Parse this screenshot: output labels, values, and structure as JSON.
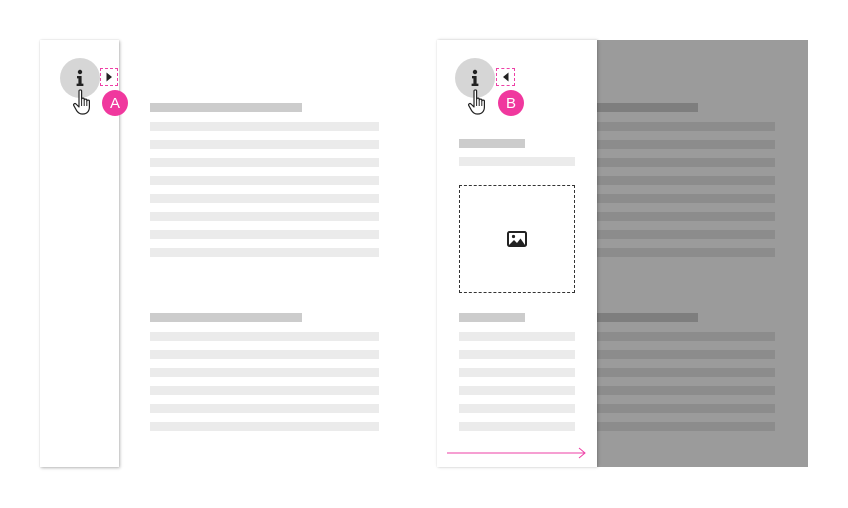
{
  "panel_a": {
    "badge": "A",
    "icons": {
      "info": "info-icon",
      "toggle": "caret-right-icon",
      "cursor": "hand-pointer-icon"
    }
  },
  "panel_b": {
    "badge": "B",
    "icons": {
      "info": "info-icon",
      "toggle": "caret-left-icon",
      "cursor": "hand-pointer-icon",
      "image": "image-icon",
      "arrow": "arrow-right-icon"
    }
  },
  "colors": {
    "accent": "#f0389e",
    "overlay": "#9b9b9b",
    "placeholder_heading": "#cccccc",
    "placeholder_text": "#ebebeb"
  }
}
